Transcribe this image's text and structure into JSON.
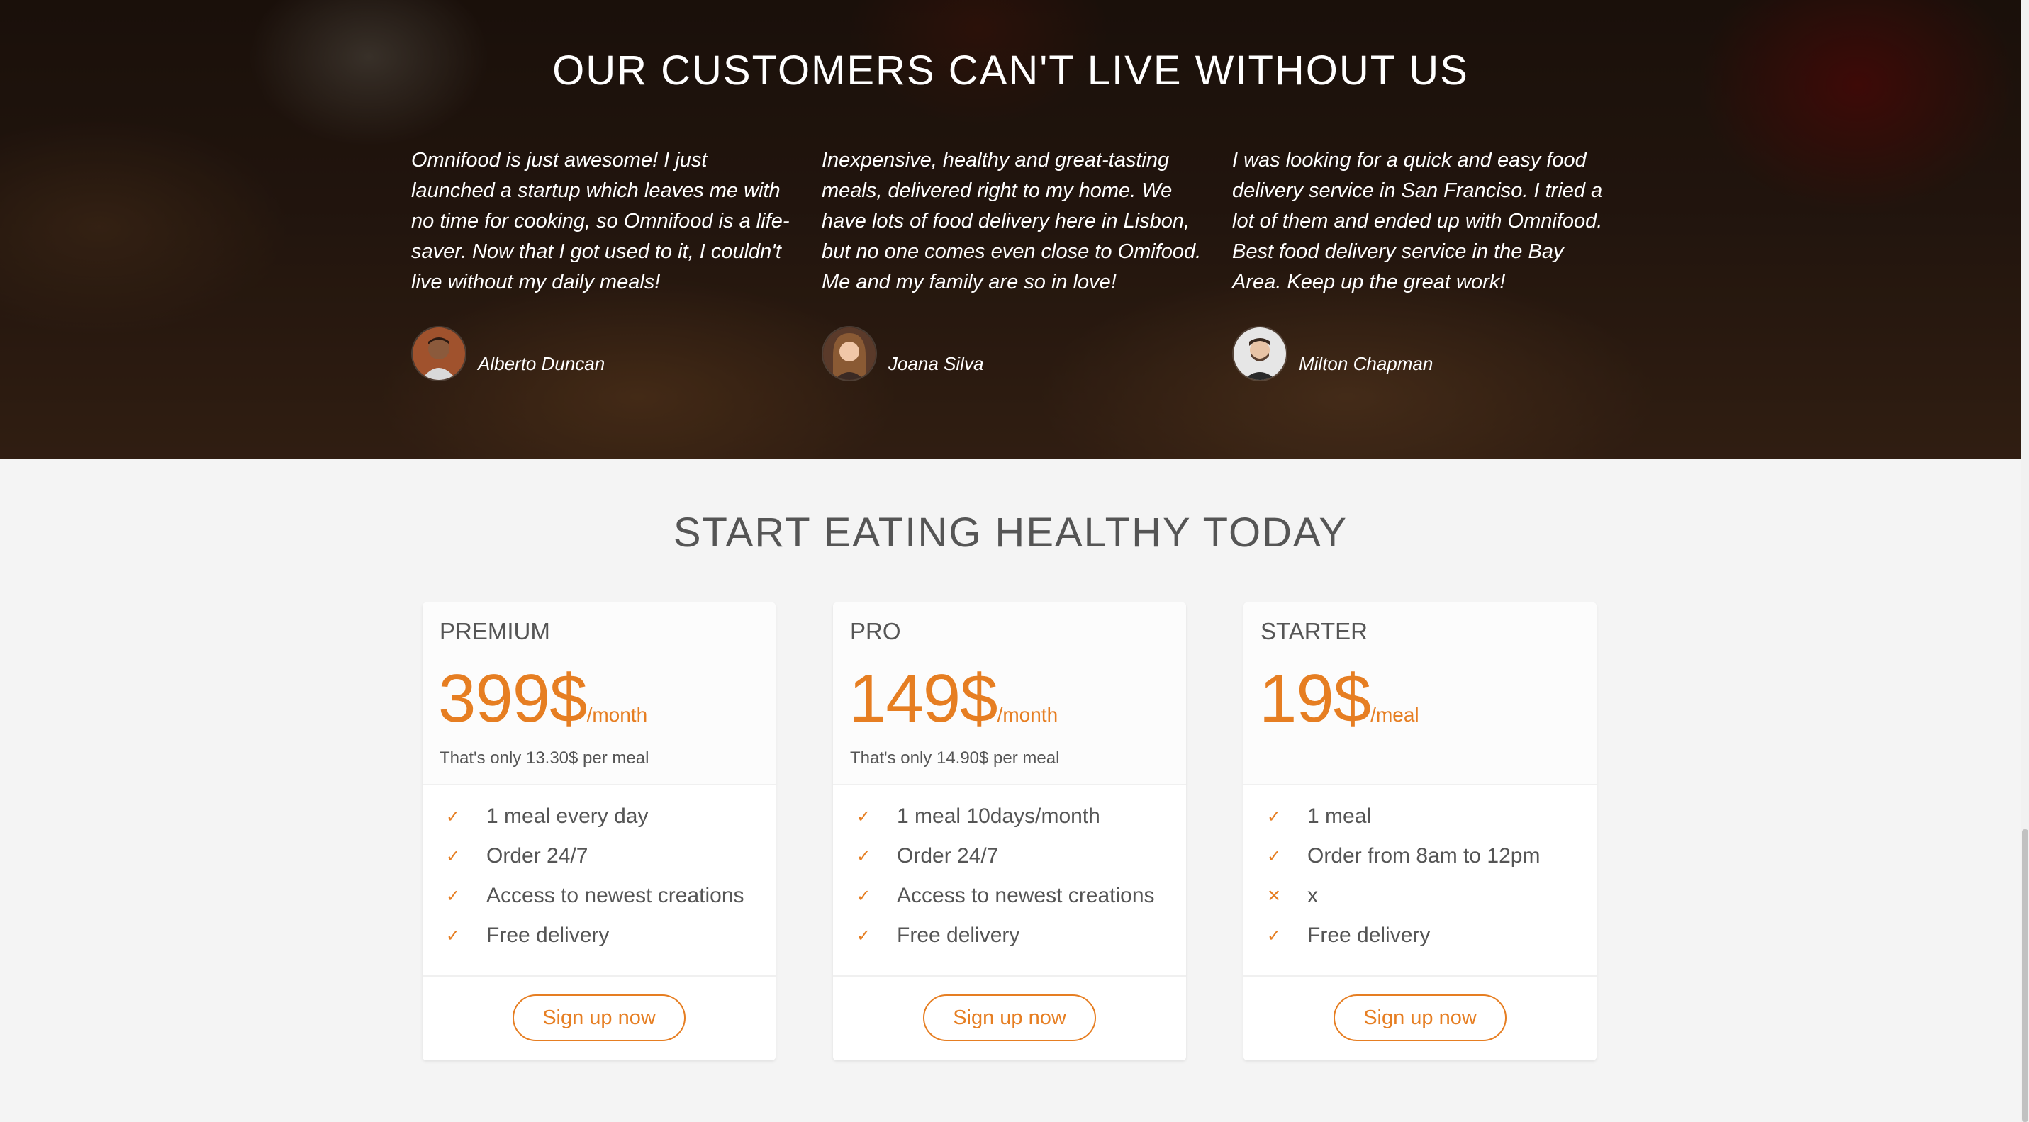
{
  "testimonials": {
    "title": "OUR CUSTOMERS CAN'T LIVE WITHOUT US",
    "items": [
      {
        "quote": "Omnifood is just awesome! I just launched a startup which leaves me with no time for cooking, so Omnifood is a life-saver. Now that I got used to it, I couldn't live without my daily meals!",
        "author": "Alberto Duncan"
      },
      {
        "quote": "Inexpensive, healthy and great-tasting meals, delivered right to my home. We have lots of food delivery here in Lisbon, but no one comes even close to Omifood. Me and my family are so in love!",
        "author": "Joana Silva"
      },
      {
        "quote": "I was looking for a quick and easy food delivery service in San Franciso. I tried a lot of them and ended up with Omnifood. Best food delivery service in the Bay Area. Keep up the great work!",
        "author": "Milton Chapman"
      }
    ]
  },
  "plans": {
    "title": "START EATING HEALTHY TODAY",
    "accent_color": "#e67e22",
    "cards": [
      {
        "name": "PREMIUM",
        "price": "399$",
        "unit": "/month",
        "note": "That's only 13.30$ per meal",
        "features": [
          {
            "icon": "checkmark-icon",
            "text": "1 meal every day"
          },
          {
            "icon": "checkmark-icon",
            "text": "Order 24/7"
          },
          {
            "icon": "checkmark-icon",
            "text": "Access to newest creations"
          },
          {
            "icon": "checkmark-icon",
            "text": "Free delivery"
          }
        ],
        "button": "Sign up now"
      },
      {
        "name": "PRO",
        "price": "149$",
        "unit": "/month",
        "note": "That's only 14.90$ per meal",
        "features": [
          {
            "icon": "checkmark-icon",
            "text": "1 meal 10days/month"
          },
          {
            "icon": "checkmark-icon",
            "text": "Order 24/7"
          },
          {
            "icon": "checkmark-icon",
            "text": "Access to newest creations"
          },
          {
            "icon": "checkmark-icon",
            "text": "Free delivery"
          }
        ],
        "button": "Sign up now"
      },
      {
        "name": "STARTER",
        "price": "19$",
        "unit": "/meal",
        "note": "",
        "features": [
          {
            "icon": "checkmark-icon",
            "text": "1 meal"
          },
          {
            "icon": "checkmark-icon",
            "text": "Order from 8am to 12pm"
          },
          {
            "icon": "cross-icon",
            "text": "x"
          },
          {
            "icon": "checkmark-icon",
            "text": "Free delivery"
          }
        ],
        "button": "Sign up now"
      }
    ]
  }
}
